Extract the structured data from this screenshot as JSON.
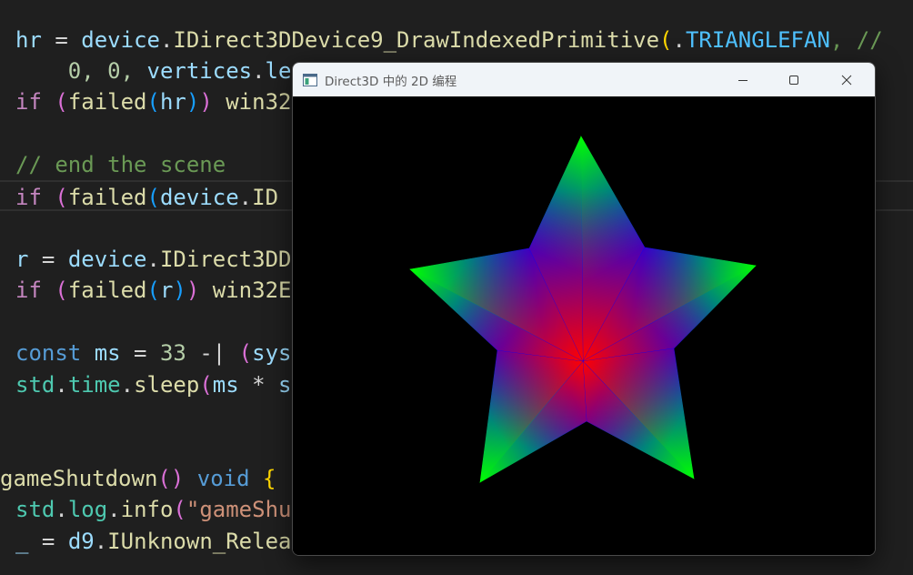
{
  "editor": {
    "lines": [
      [
        [
          "hr",
          "var"
        ],
        [
          " = ",
          "op"
        ],
        [
          "device",
          "var"
        ],
        [
          ".",
          "op"
        ],
        [
          "IDirect3DDevice9_DrawIndexedPrimitive",
          "fn"
        ],
        [
          "(",
          "p1"
        ],
        [
          ".",
          "op"
        ],
        [
          "TRIANGLEFAN",
          "cst"
        ],
        [
          ", //",
          "com"
        ]
      ],
      [
        [
          "    0, 0, ",
          "num"
        ],
        [
          "vertices",
          "var"
        ],
        [
          ".",
          "op"
        ],
        [
          "le",
          "var"
        ]
      ],
      [
        [
          "if",
          "ctl"
        ],
        [
          " ",
          "op"
        ],
        [
          "(",
          "p2"
        ],
        [
          "failed",
          "fn"
        ],
        [
          "(",
          "p3"
        ],
        [
          "hr",
          "var"
        ],
        [
          ")",
          "p3"
        ],
        [
          ")",
          "p2"
        ],
        [
          " win32",
          "fn"
        ]
      ],
      [],
      [
        [
          "// end the scene",
          "com"
        ]
      ],
      [
        [
          "if",
          "ctl"
        ],
        [
          " ",
          "op"
        ],
        [
          "(",
          "p2"
        ],
        [
          "failed",
          "fn"
        ],
        [
          "(",
          "p3"
        ],
        [
          "device",
          "var"
        ],
        [
          ".",
          "op"
        ],
        [
          "ID",
          "fn"
        ]
      ],
      [],
      [
        [
          "r",
          "var"
        ],
        [
          " = ",
          "op"
        ],
        [
          "device",
          "var"
        ],
        [
          ".",
          "op"
        ],
        [
          "IDirect3DD",
          "fn"
        ]
      ],
      [
        [
          "if",
          "ctl"
        ],
        [
          " ",
          "op"
        ],
        [
          "(",
          "p2"
        ],
        [
          "failed",
          "fn"
        ],
        [
          "(",
          "p3"
        ],
        [
          "r",
          "var"
        ],
        [
          ")",
          "p3"
        ],
        [
          ")",
          "p2"
        ],
        [
          " win32E",
          "fn"
        ]
      ],
      [],
      [
        [
          "const",
          "kw"
        ],
        [
          " ",
          "op"
        ],
        [
          "ms",
          "var"
        ],
        [
          " = ",
          "op"
        ],
        [
          "33",
          "num"
        ],
        [
          " -| ",
          "op"
        ],
        [
          "(",
          "p2"
        ],
        [
          "sys",
          "var"
        ]
      ],
      [
        [
          "std",
          "typ"
        ],
        [
          ".",
          "op"
        ],
        [
          "time",
          "typ"
        ],
        [
          ".",
          "op"
        ],
        [
          "sleep",
          "fn"
        ],
        [
          "(",
          "p2"
        ],
        [
          "ms",
          "var"
        ],
        [
          " * ",
          "op"
        ],
        [
          "s",
          "var"
        ]
      ],
      [],
      [],
      [
        [
          "gameShutdown",
          "fn"
        ],
        [
          "()",
          "p2"
        ],
        [
          " ",
          "op"
        ],
        [
          "void",
          "kw"
        ],
        [
          " ",
          "op"
        ],
        [
          "{",
          "p1"
        ]
      ],
      [
        [
          "std",
          "typ"
        ],
        [
          ".",
          "op"
        ],
        [
          "log",
          "typ"
        ],
        [
          ".",
          "op"
        ],
        [
          "info",
          "fn"
        ],
        [
          "(",
          "p2"
        ],
        [
          "\"gameShu",
          "str"
        ]
      ],
      [
        [
          "_",
          "var"
        ],
        [
          " = ",
          "op"
        ],
        [
          "d9",
          "var"
        ],
        [
          ".",
          "op"
        ],
        [
          "IUnknown_Relea",
          "fn"
        ]
      ]
    ]
  },
  "window": {
    "title": "Direct3D 中的 2D 编程",
    "minimize_icon": "minimize-icon",
    "maximize_icon": "maximize-icon",
    "close_icon": "close-icon",
    "app_icon": "app-window-icon"
  },
  "scene": {
    "shape": "five-point star",
    "center_color": "#ff0000",
    "inner_vertex_color": "#0000ff",
    "outer_vertex_color": "#00ff00",
    "background_color": "#000000"
  }
}
